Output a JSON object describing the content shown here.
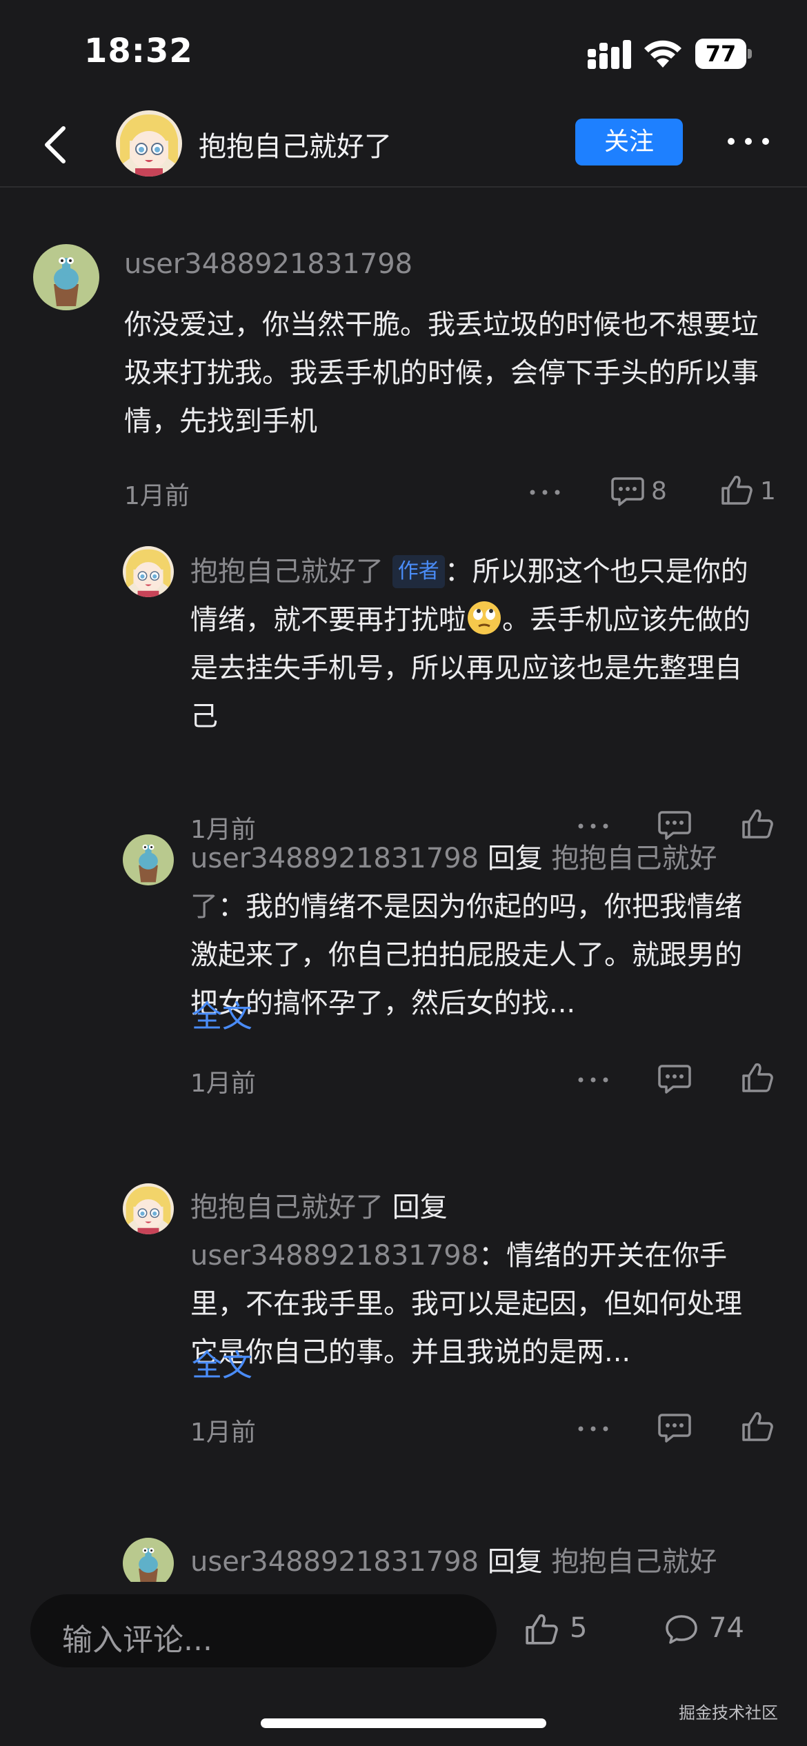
{
  "status_bar": {
    "time": "18:32",
    "battery": "77",
    "icons": [
      "signal-icon",
      "wifi-icon",
      "battery-icon"
    ]
  },
  "header": {
    "title": "抱抱自己就好了",
    "follow_label": "关注",
    "icons": [
      "back-icon",
      "more-icon"
    ]
  },
  "comments": [
    {
      "username": "user3488921831798",
      "text": "你没爱过，你当然干脆。我丢垃圾的时候也不想要垃圾来打扰我。我丢手机的时候，会停下手头的所以事情，先找到手机",
      "time": "1月前",
      "comment_count": "8",
      "like_count": "1"
    }
  ],
  "replies": [
    {
      "username": "抱抱自己就好了",
      "badge": "作者",
      "text_before_emoji": "：所以那这个也只是你的情绪，就不要再打扰啦",
      "emoji": "eye-roll-emoji",
      "text_after_emoji": "。丢手机应该先做的是去挂失手机号，所以再见应该也是先整理自己",
      "time": "1月前"
    },
    {
      "username": "user3488921831798",
      "reply_word": "回复",
      "reply_to": "抱抱自己就好了",
      "text": "：我的情绪不是因为你起的吗，你把我情绪激起来了，你自己拍拍屁股走人了。就跟男的把女的搞怀孕了，然后女的找...",
      "full_text_label": "全文",
      "time": "1月前"
    },
    {
      "username": "抱抱自己就好了",
      "reply_word": "回复",
      "reply_to": "user3488921831798",
      "text": "：情绪的开关在你手里，不在我手里。我可以是起因，但如何处理它是你自己的事。并且我说的是两...",
      "full_text_label": "全文",
      "time": "1月前"
    },
    {
      "username": "user3488921831798",
      "reply_word": "回复",
      "reply_to": "抱抱自己就好"
    }
  ],
  "bottom_bar": {
    "input_placeholder": "输入评论...",
    "like_count": "5",
    "comment_count": "74",
    "watermark": "掘金技术社区"
  },
  "colors": {
    "background": "#1a1a1c",
    "accent": "#1e80ff",
    "link": "#4a8cf7",
    "muted_text": "#8a8a8e"
  }
}
